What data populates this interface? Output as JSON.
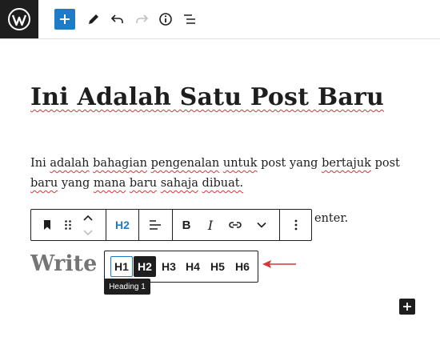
{
  "topbar": {
    "logo": "wordpress-logo",
    "add_block_icon": "plus-icon",
    "tools_icon": "pencil-icon",
    "undo_icon": "undo-icon",
    "redo_icon": "redo-icon",
    "info_icon": "info-icon",
    "outline_icon": "list-view-icon"
  },
  "post": {
    "title": "Ini Adalah Satu Post Baru",
    "paragraph_words": [
      {
        "t": "Ini",
        "sq": false
      },
      {
        "t": "adalah",
        "sq": true
      },
      {
        "t": "bahagian",
        "sq": true
      },
      {
        "t": "pengenalan",
        "sq": true
      },
      {
        "t": "untuk",
        "sq": true
      },
      {
        "t": "post",
        "sq": false
      },
      {
        "t": "yang",
        "sq": false
      },
      {
        "t": "bertajuk",
        "sq": true
      },
      {
        "t": "post",
        "sq": false
      },
      {
        "t": "baru",
        "sq": true
      },
      {
        "t": "yang",
        "sq": false
      },
      {
        "t": "mana",
        "sq": true
      },
      {
        "t": "baru",
        "sq": true
      },
      {
        "t": "sahaja",
        "sq": true
      },
      {
        "t": "dibuat.",
        "sq": true
      }
    ],
    "paragraph_tail": "enter.",
    "heading_placeholder": "Write h"
  },
  "block_toolbar": {
    "block_icon": "bookmark-icon",
    "drag_icon": "drag-handle-icon",
    "move_up_icon": "chevron-up-icon",
    "move_down_icon": "chevron-down-icon",
    "heading_level": "H2",
    "align_icon": "align-left-icon",
    "bold_label": "B",
    "italic_label": "I",
    "link_icon": "link-icon",
    "more_formatting_icon": "chevron-down-icon",
    "options_icon": "more-vertical-icon"
  },
  "heading_levels": {
    "options": [
      "H1",
      "H2",
      "H3",
      "H4",
      "H5",
      "H6"
    ],
    "selected": "H2",
    "focused": "H1",
    "tooltip": "Heading 1"
  },
  "annotation": {
    "arrow_color": "#d63638"
  },
  "colors": {
    "accent": "#1e7bc7",
    "dark": "#1e1e1e",
    "placeholder": "#757575",
    "spellcheck": "#d63638"
  },
  "inserter_icon": "plus-icon"
}
